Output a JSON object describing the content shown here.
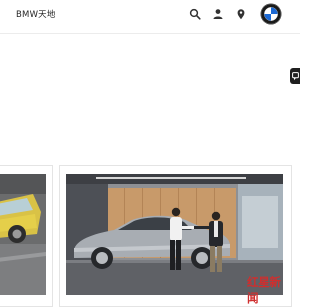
{
  "header": {
    "brand": "BMW天地",
    "icons": [
      "search-icon",
      "user-icon",
      "location-pin-icon"
    ],
    "logo": "bmw-roundel-logo"
  },
  "side_tab": {
    "icon": "feedback-icon"
  },
  "cards": [
    {
      "image": "yellow-car-partial-photo"
    },
    {
      "image": "showroom-handshake-photo"
    }
  ],
  "watermark": "红星新闻",
  "colors": {
    "brand_blue": "#1c69d4",
    "watermark_red": "#cf2e2e",
    "text_dark": "#262626"
  }
}
